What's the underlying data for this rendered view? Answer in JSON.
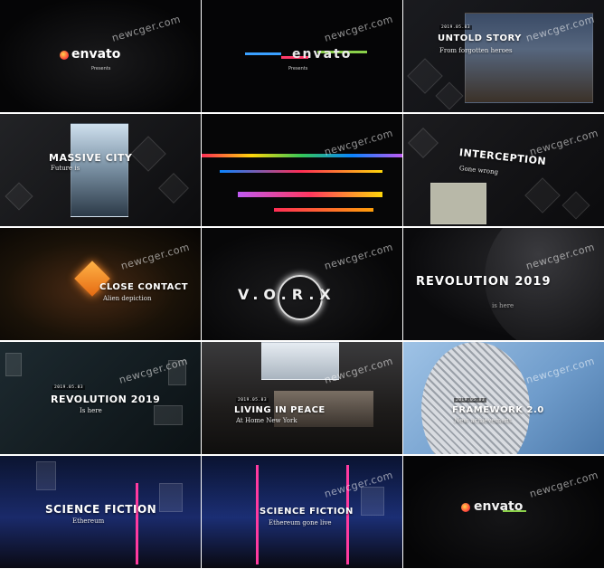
{
  "watermark": "newcger.com",
  "logo": {
    "wordmark": "envato",
    "presents": "Presents"
  },
  "tiles": [
    {
      "id": "intro-logo",
      "title": "envato",
      "subtitle": "Presents"
    },
    {
      "id": "glitch-logo",
      "title": "envato",
      "subtitle": "Presents"
    },
    {
      "id": "untold-story",
      "date": "2019.05.03",
      "title": "UNTOLD STORY",
      "subtitle": "From forgotten heroes"
    },
    {
      "id": "massive-city",
      "title": "MASSIVE CITY",
      "subtitle": "Future is"
    },
    {
      "id": "glitch-transition"
    },
    {
      "id": "interception",
      "title": "INTERCEPTION",
      "subtitle": "Gone wrong"
    },
    {
      "id": "close-contact",
      "title": "CLOSE CONTACT",
      "subtitle": "Alien depiction"
    },
    {
      "id": "tunnel",
      "title": "V.O.R.X"
    },
    {
      "id": "revolution-glitch",
      "title": "REVOLUTION 2019",
      "subtitle": "is here"
    },
    {
      "id": "revolution-2019",
      "date": "2019.05.03",
      "title": "REVOLUTION 2019",
      "subtitle": "Is here"
    },
    {
      "id": "living-in-peace",
      "date": "2019.05.03",
      "title": "LIVING IN PEACE",
      "subtitle": "At Home New York"
    },
    {
      "id": "framework",
      "date": "2019.05.03",
      "title": "FRAMEWORK 2.0",
      "subtitle": "New achievement"
    },
    {
      "id": "science-fiction-1",
      "title": "SCIENCE FICTION",
      "subtitle": "Ethereum"
    },
    {
      "id": "science-fiction-2",
      "title": "SCIENCE FICTION",
      "subtitle": "Ethereum gone live"
    },
    {
      "id": "outro-logo",
      "title": "envato"
    }
  ]
}
